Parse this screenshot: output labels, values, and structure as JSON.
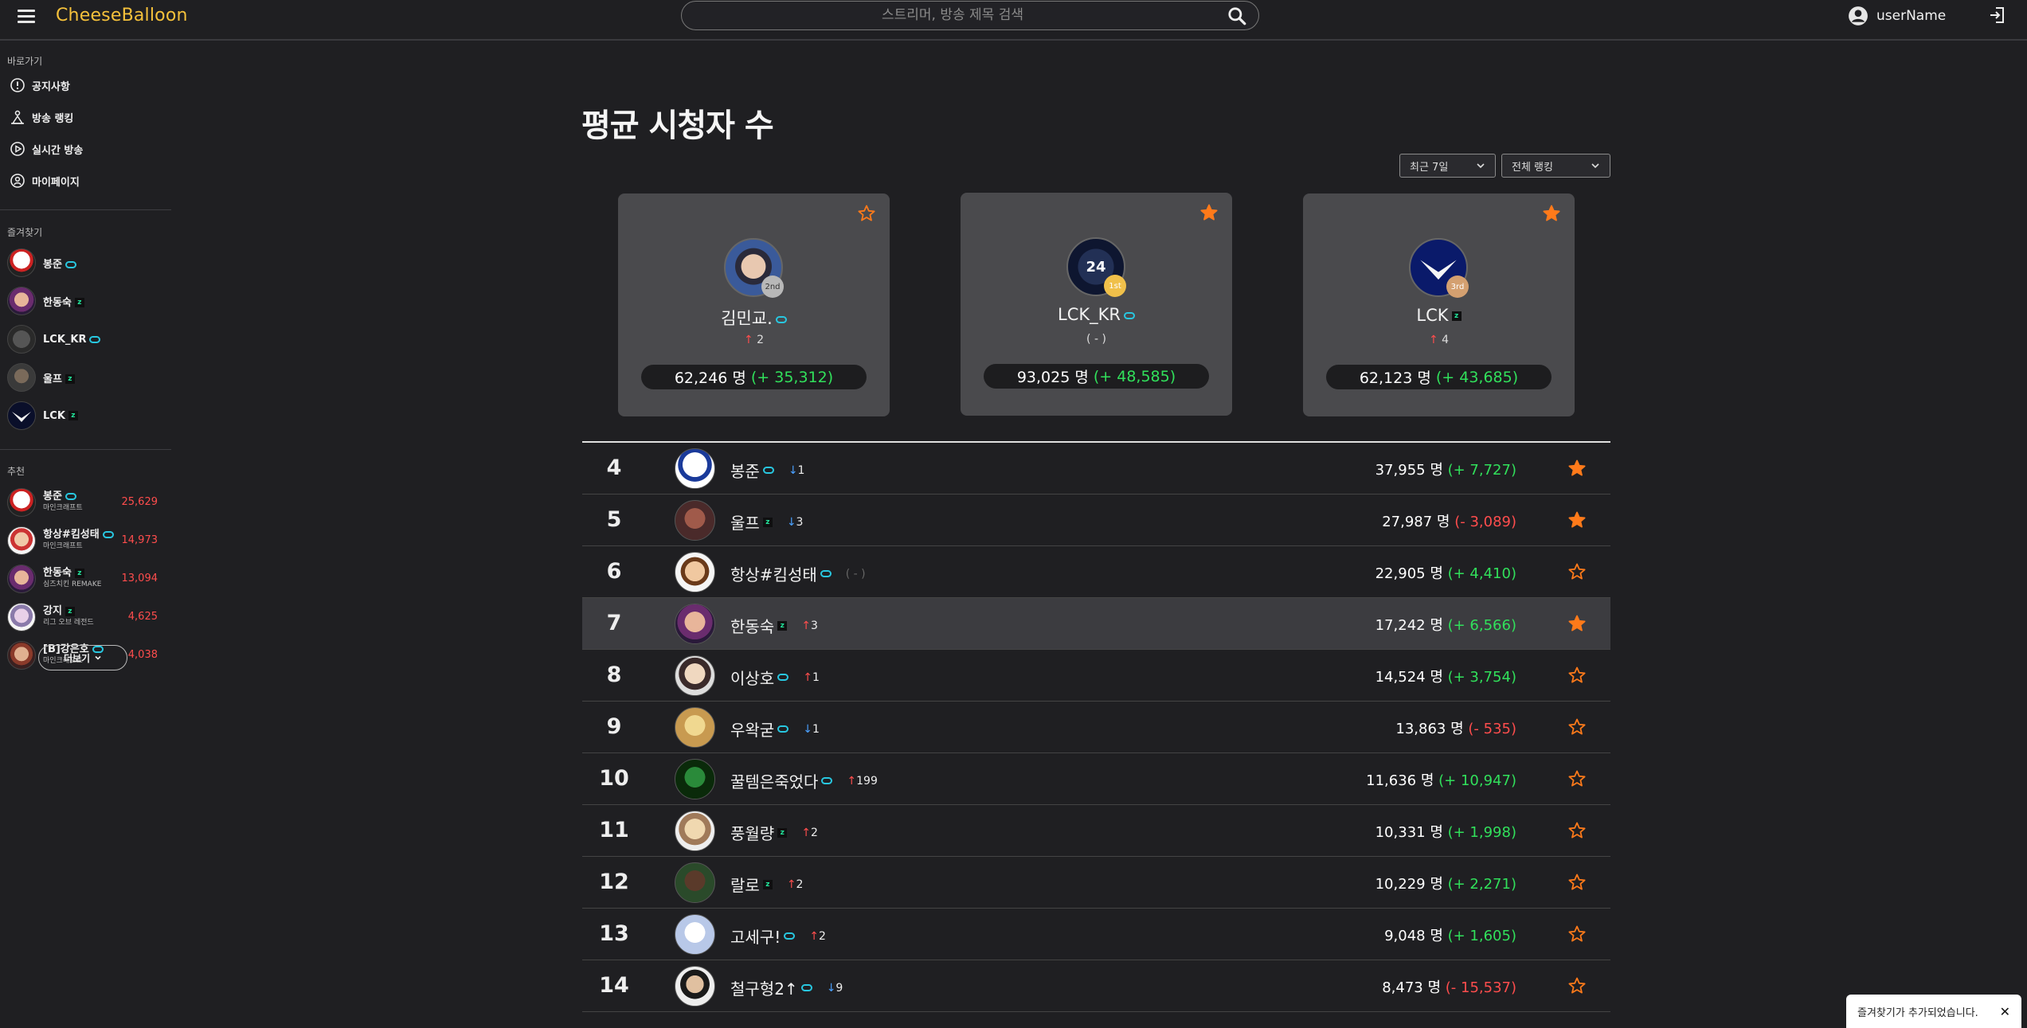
{
  "header": {
    "brand": "CheeseBalloon",
    "search_placeholder": "스트리머, 방송 제목 검색",
    "username": "userName"
  },
  "sidebar": {
    "shortcut_title": "바로가기",
    "nav": [
      {
        "label": "공지사항",
        "icon": "info-icon"
      },
      {
        "label": "방송 랭킹",
        "icon": "ranking-icon"
      },
      {
        "label": "실시간 방송",
        "icon": "play-icon"
      },
      {
        "label": "마이페이지",
        "icon": "user-icon"
      }
    ],
    "favorites_title": "즐겨찾기",
    "favorites": [
      {
        "name": "봉준",
        "platform": "afreeca"
      },
      {
        "name": "한동숙",
        "platform": "chzzk"
      },
      {
        "name": "LCK_KR",
        "platform": "afreeca"
      },
      {
        "name": "울프",
        "platform": "chzzk"
      },
      {
        "name": "LCK",
        "platform": "chzzk"
      }
    ],
    "recommend_title": "추천",
    "recommend": [
      {
        "name": "봉준",
        "category": "마인크래프트",
        "viewers": "25,629",
        "platform": "afreeca"
      },
      {
        "name": "항상#킴성태",
        "category": "마인크래프트",
        "viewers": "14,973",
        "platform": "afreeca"
      },
      {
        "name": "한동숙",
        "category": "심즈치킨 REMAKE",
        "viewers": "13,094",
        "platform": "chzzk"
      },
      {
        "name": "강지",
        "category": "리그 오브 레전드",
        "viewers": "4,625",
        "platform": "chzzk"
      },
      {
        "name": "[B]강은호",
        "category": "마인크래프트",
        "viewers": "4,038",
        "platform": "afreeca"
      }
    ],
    "more_label": "더보기"
  },
  "main": {
    "title": "평균 시청자 수",
    "period_select": "최근 7일",
    "scope_select": "전체 랭킹",
    "top3": [
      {
        "name": "김민교.",
        "medal": "2nd",
        "change_dir": "up",
        "change": "2",
        "viewers": "62,246 명",
        "delta": "(+ 35,312)",
        "favorite": false,
        "platform": "afreeca"
      },
      {
        "name": "LCK_KR",
        "medal": "1st",
        "change_dir": "none",
        "change": "( - )",
        "viewers": "93,025 명",
        "delta": "(+ 48,585)",
        "favorite": true,
        "platform": "afreeca"
      },
      {
        "name": "LCK",
        "medal": "3rd",
        "change_dir": "up",
        "change": "4",
        "viewers": "62,123 명",
        "delta": "(+ 43,685)",
        "favorite": true,
        "platform": "chzzk"
      }
    ],
    "rows": [
      {
        "rank": "4",
        "name": "봉준",
        "platform": "afreeca",
        "change_dir": "down",
        "change": "1",
        "viewers": "37,955 명",
        "delta": "(+ 7,727)",
        "delta_sign": "pos",
        "favorite": true
      },
      {
        "rank": "5",
        "name": "울프",
        "platform": "chzzk",
        "change_dir": "down",
        "change": "3",
        "viewers": "27,987 명",
        "delta": "(- 3,089)",
        "delta_sign": "neg",
        "favorite": true
      },
      {
        "rank": "6",
        "name": "항상#킴성태",
        "platform": "afreeca",
        "change_dir": "none",
        "change": "( - )",
        "viewers": "22,905 명",
        "delta": "(+ 4,410)",
        "delta_sign": "pos",
        "favorite": false
      },
      {
        "rank": "7",
        "name": "한동숙",
        "platform": "chzzk",
        "change_dir": "up",
        "change": "3",
        "viewers": "17,242 명",
        "delta": "(+ 6,566)",
        "delta_sign": "pos",
        "favorite": true
      },
      {
        "rank": "8",
        "name": "이상호",
        "platform": "afreeca",
        "change_dir": "up",
        "change": "1",
        "viewers": "14,524 명",
        "delta": "(+ 3,754)",
        "delta_sign": "pos",
        "favorite": false
      },
      {
        "rank": "9",
        "name": "우왁굳",
        "platform": "afreeca",
        "change_dir": "down",
        "change": "1",
        "viewers": "13,863 명",
        "delta": "(- 535)",
        "delta_sign": "neg",
        "favorite": false
      },
      {
        "rank": "10",
        "name": "꿀템은죽었다",
        "platform": "afreeca",
        "change_dir": "up",
        "change": "199",
        "viewers": "11,636 명",
        "delta": "(+ 10,947)",
        "delta_sign": "pos",
        "favorite": false
      },
      {
        "rank": "11",
        "name": "풍월량",
        "platform": "chzzk",
        "change_dir": "up",
        "change": "2",
        "viewers": "10,331 명",
        "delta": "(+ 1,998)",
        "delta_sign": "pos",
        "favorite": false
      },
      {
        "rank": "12",
        "name": "랄로",
        "platform": "chzzk",
        "change_dir": "up",
        "change": "2",
        "viewers": "10,229 명",
        "delta": "(+ 2,271)",
        "delta_sign": "pos",
        "favorite": false
      },
      {
        "rank": "13",
        "name": "고세구!",
        "platform": "afreeca",
        "change_dir": "up",
        "change": "2",
        "viewers": "9,048 명",
        "delta": "(+ 1,605)",
        "delta_sign": "pos",
        "favorite": false
      },
      {
        "rank": "14",
        "name": "철구형2↑",
        "platform": "afreeca",
        "change_dir": "down",
        "change": "9",
        "viewers": "8,473 명",
        "delta": "(- 15,537)",
        "delta_sign": "neg",
        "favorite": false
      }
    ]
  },
  "toast": {
    "message": "즐겨찾기가 추가되었습니다."
  },
  "colors": {
    "brand": "#f5c13b",
    "star": "#ff7a1a",
    "positive": "#31e05b",
    "negative": "#ff4d4d",
    "afreeca_badge": "#28c7e0",
    "chzzk_badge": "#22e39a"
  }
}
